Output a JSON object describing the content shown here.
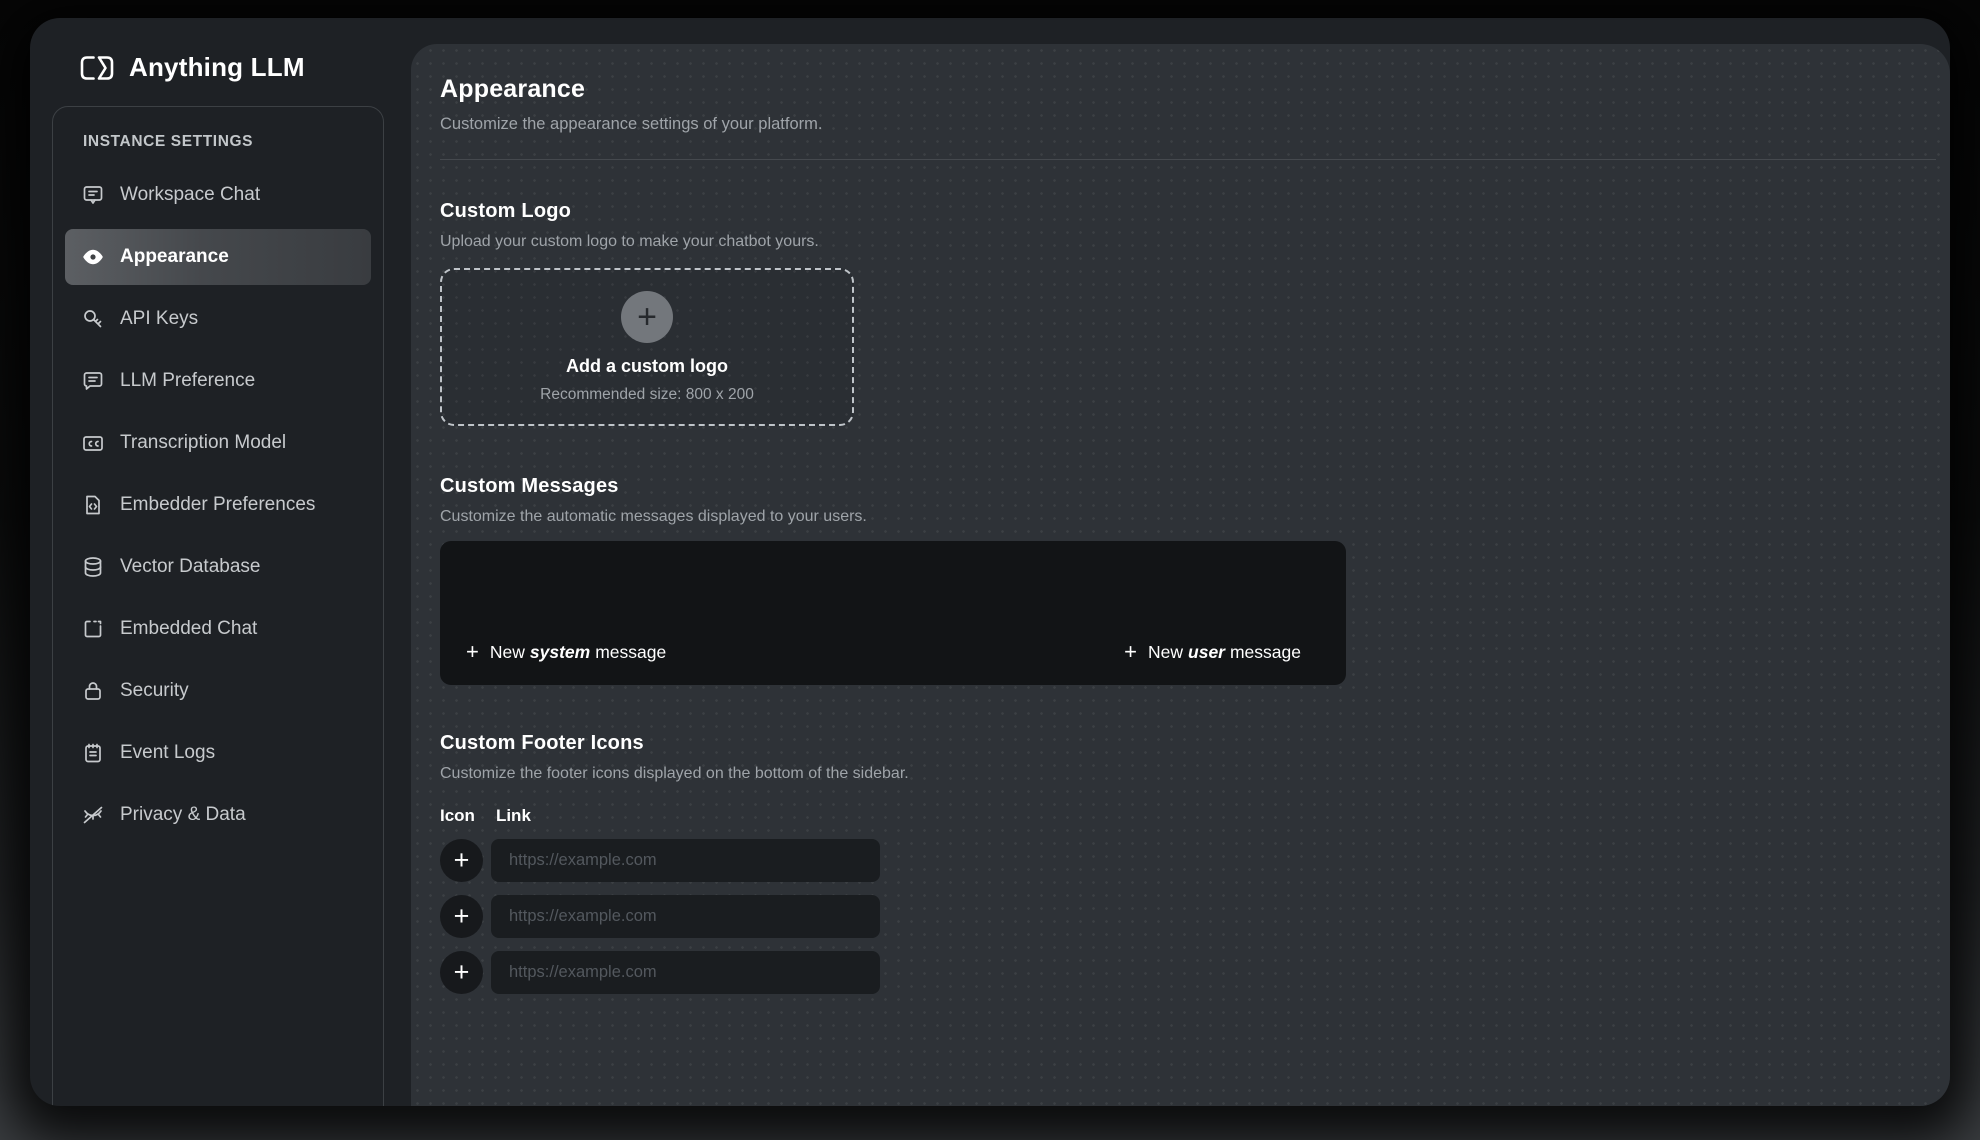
{
  "app": {
    "logo_text": "Anything LLM"
  },
  "sidebar": {
    "section_label": "INSTANCE SETTINGS",
    "items": [
      {
        "label": "Workspace Chat",
        "icon": "workspace-chat-icon",
        "active": false
      },
      {
        "label": "Appearance",
        "icon": "eye-icon",
        "active": true
      },
      {
        "label": "API Keys",
        "icon": "key-icon",
        "active": false
      },
      {
        "label": "LLM Preference",
        "icon": "message-icon",
        "active": false
      },
      {
        "label": "Transcription Model",
        "icon": "captions-icon",
        "active": false
      },
      {
        "label": "Embedder Preferences",
        "icon": "file-code-icon",
        "active": false
      },
      {
        "label": "Vector Database",
        "icon": "database-icon",
        "active": false
      },
      {
        "label": "Embedded Chat",
        "icon": "embed-chat-icon",
        "active": false
      },
      {
        "label": "Security",
        "icon": "lock-icon",
        "active": false
      },
      {
        "label": "Event Logs",
        "icon": "notepad-icon",
        "active": false
      },
      {
        "label": "Privacy & Data",
        "icon": "eye-off-icon",
        "active": false
      }
    ]
  },
  "header": {
    "title": "Appearance",
    "subtitle": "Customize the appearance settings of your platform."
  },
  "custom_logo": {
    "title": "Custom Logo",
    "description": "Upload your custom logo to make your chatbot yours.",
    "plus": "+",
    "upload_label": "Add a custom logo",
    "upload_hint": "Recommended size: 800 x 200"
  },
  "custom_messages": {
    "title": "Custom Messages",
    "description": "Customize the automatic messages displayed to your users.",
    "new_system": {
      "plus": "+",
      "prefix": "New",
      "emph": "system",
      "suffix": "message"
    },
    "new_user": {
      "plus": "+",
      "prefix": "New",
      "emph": "user",
      "suffix": "message"
    }
  },
  "footer_icons": {
    "title": "Custom Footer Icons",
    "description": "Customize the footer icons displayed on the bottom of the sidebar.",
    "col_icon": "Icon",
    "col_link": "Link",
    "plus": "+",
    "rows": [
      {
        "placeholder": "https://example.com",
        "value": ""
      },
      {
        "placeholder": "https://example.com",
        "value": ""
      },
      {
        "placeholder": "https://example.com",
        "value": ""
      }
    ]
  },
  "colors": {
    "window_bg": "#1e2125",
    "panel_bg": "#2e3237",
    "dark_panel_bg": "#121416",
    "input_bg": "#1a1d20",
    "text_primary": "#ffffff",
    "text_secondary": "#9fa4a9"
  }
}
